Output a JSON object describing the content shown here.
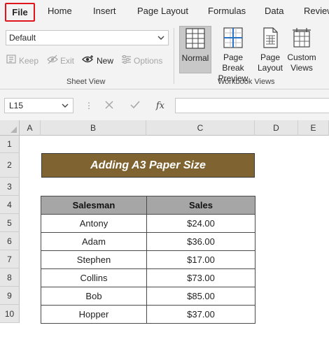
{
  "ribbon_tabs": {
    "file": "File",
    "home": "Home",
    "insert": "Insert",
    "page_layout": "Page Layout",
    "formulas": "Formulas",
    "data": "Data",
    "review": "Review"
  },
  "sheet_view": {
    "selected_view": "Default",
    "keep": "Keep",
    "exit": "Exit",
    "new": "New",
    "options": "Options",
    "group_label": "Sheet View"
  },
  "workbook_views": {
    "normal": "Normal",
    "page_break_line1": "Page Break",
    "page_break_line2": "Preview",
    "page_layout_line1": "Page",
    "page_layout_line2": "Layout",
    "custom_line1": "Custom",
    "custom_line2": "Views",
    "group_label": "Workbook Views"
  },
  "formula_bar": {
    "name_box": "L15",
    "fx": "fx",
    "formula": ""
  },
  "columns": [
    "A",
    "B",
    "C",
    "D",
    "E"
  ],
  "rows": [
    "1",
    "2",
    "3",
    "4",
    "5",
    "6",
    "7",
    "8",
    "9",
    "10"
  ],
  "sheet": {
    "title": "Adding A3 Paper Size",
    "headers": [
      "Salesman",
      "Sales"
    ],
    "records": [
      {
        "salesman": "Antony",
        "sales": "$24.00"
      },
      {
        "salesman": "Adam",
        "sales": "$36.00"
      },
      {
        "salesman": "Stephen",
        "sales": "$17.00"
      },
      {
        "salesman": "Collins",
        "sales": "$73.00"
      },
      {
        "salesman": "Bob",
        "sales": "$85.00"
      },
      {
        "salesman": "Hopper",
        "sales": "$37.00"
      }
    ]
  },
  "colors": {
    "title_fill": "#7f6431",
    "header_fill": "#a6a6a6",
    "file_highlight": "#e0151c"
  },
  "icons": [
    "chevron-down-icon",
    "keep-icon",
    "exit-icon",
    "new-view-icon",
    "options-icon",
    "normal-view-icon",
    "page-break-icon",
    "page-layout-icon",
    "custom-views-icon",
    "cancel-icon",
    "enter-icon",
    "insert-function-icon",
    "select-all-icon"
  ]
}
